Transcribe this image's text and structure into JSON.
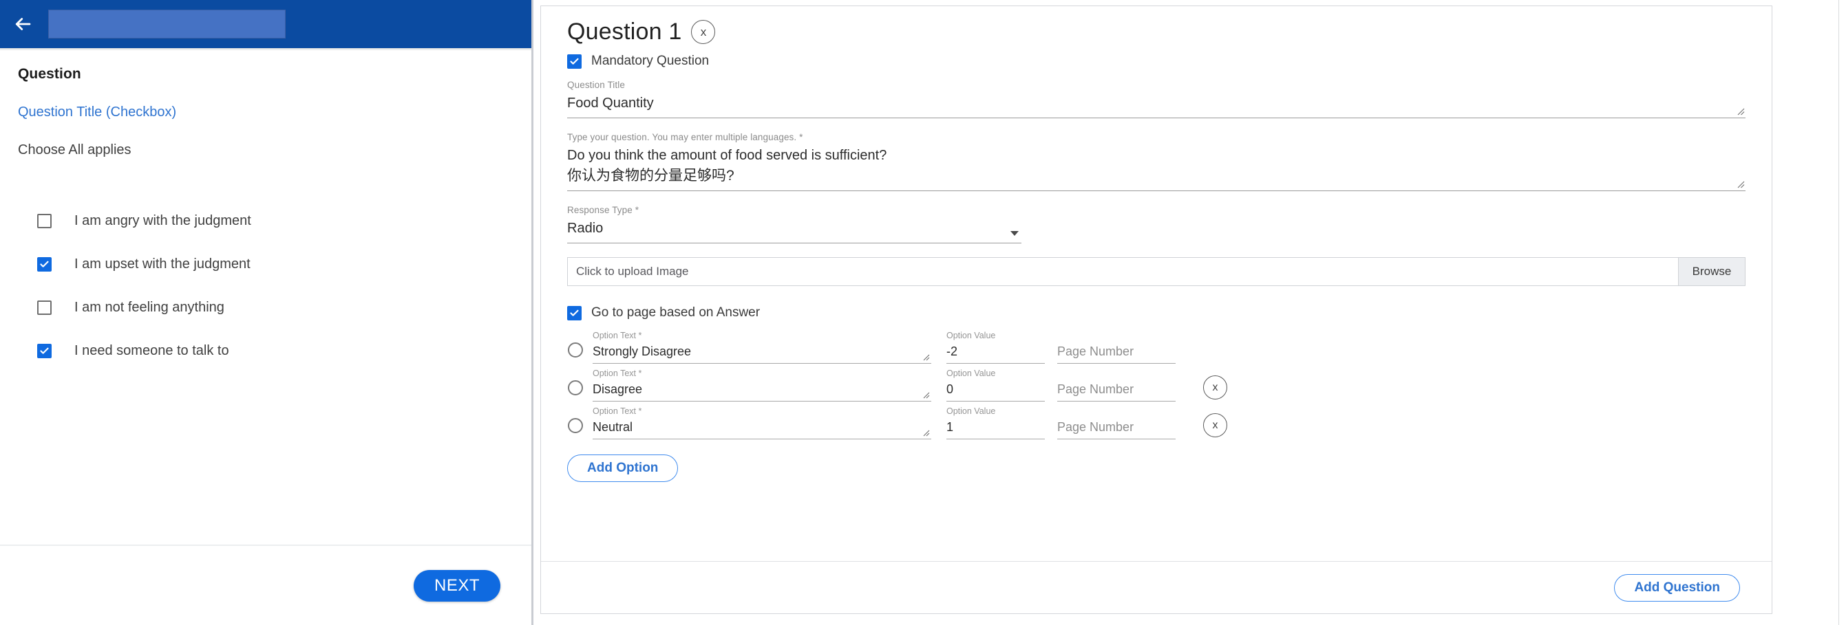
{
  "header": {
    "back_icon": "back-arrow-icon",
    "title_placeholder": ""
  },
  "preview": {
    "section_label": "Question",
    "question_title_link": "Question Title (Checkbox)",
    "instruction": "Choose All applies",
    "options": [
      {
        "label": "I am angry with the judgment",
        "checked": false
      },
      {
        "label": "I am upset with the judgment",
        "checked": true
      },
      {
        "label": "I am not feeling anything",
        "checked": false
      },
      {
        "label": "I need someone to talk to",
        "checked": true
      }
    ],
    "next_label": "NEXT"
  },
  "editor": {
    "heading": "Question 1",
    "close_label": "x",
    "mandatory": {
      "label": "Mandatory Question",
      "checked": true
    },
    "question_title": {
      "caption": "Question Title",
      "value": "Food Quantity"
    },
    "question_text": {
      "caption": "Type your question. You may enter multiple languages. *",
      "value_en": "Do you think the amount of food served is sufficient?",
      "value_zh": "你认为食物的分量足够吗?"
    },
    "response_type": {
      "caption": "Response Type *",
      "value": "Radio"
    },
    "upload": {
      "placeholder": "Click to upload Image",
      "browse_label": "Browse"
    },
    "goto_page": {
      "label": "Go to page based on Answer",
      "checked": true
    },
    "option_captions": {
      "text": "Option Text *",
      "value": "Option Value",
      "page": "Page Number"
    },
    "option_rows": [
      {
        "text": "Strongly Disagree",
        "value": "-2",
        "page_placeholder": "Page Number",
        "removable": false
      },
      {
        "text": "Disagree",
        "value": "0",
        "page_placeholder": "Page Number",
        "removable": true,
        "remove_label": "x"
      },
      {
        "text": "Neutral",
        "value": "1",
        "page_placeholder": "Page Number",
        "removable": true,
        "remove_label": "x"
      }
    ],
    "add_option_label": "Add Option",
    "add_question_label": "Add Question"
  },
  "colors": {
    "header_blue": "#0b4ba1",
    "accent_blue": "#0f6ae0",
    "link_blue": "#2f74d0",
    "outline_blue": "#3f8bee"
  }
}
